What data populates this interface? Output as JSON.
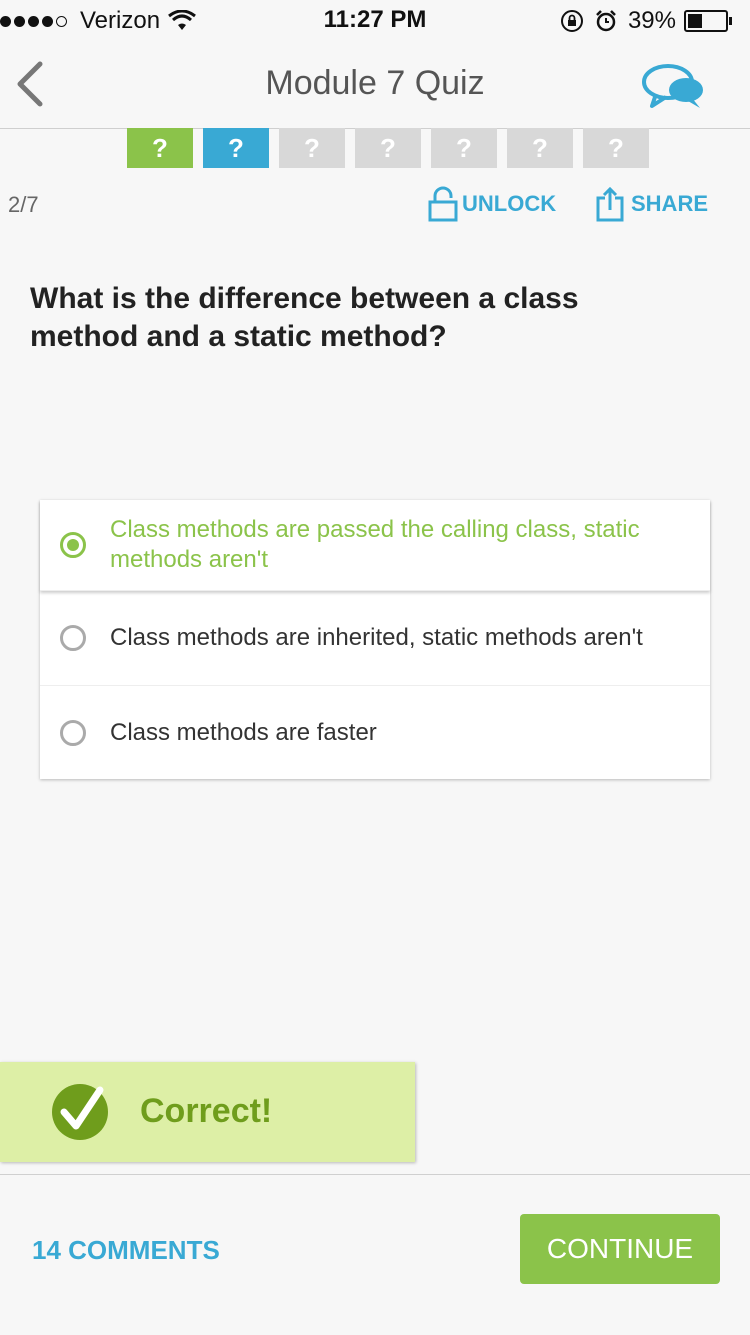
{
  "status_bar": {
    "carrier": "Verizon",
    "time": "11:27 PM",
    "battery": "39%",
    "battery_level": 0.39
  },
  "nav": {
    "title": "Module 7 Quiz",
    "back_icon": "chevron-left-icon",
    "chat_icon": "chat-bubbles-icon"
  },
  "progress": {
    "items": [
      "?",
      "?",
      "?",
      "?",
      "?",
      "?",
      "?"
    ],
    "states": [
      "correct",
      "current",
      "pending",
      "pending",
      "pending",
      "pending",
      "pending"
    ]
  },
  "toolbar": {
    "counter": "2/7",
    "unlock_label": "UNLOCK",
    "share_label": "SHARE"
  },
  "question": {
    "text": "What is the difference between a class method and a static method?"
  },
  "answers": [
    {
      "text": "Class methods are passed the calling class, static methods aren't",
      "selected": true
    },
    {
      "text": "Class methods are inherited, static methods aren't",
      "selected": false
    },
    {
      "text": "Class methods are faster",
      "selected": false
    }
  ],
  "feedback": {
    "text": "Correct!"
  },
  "footer": {
    "comments_label": "14 COMMENTS",
    "continue_label": "CONTINUE"
  },
  "colors": {
    "accent_green": "#8bc34a",
    "accent_blue": "#39a9d4",
    "toast_bg": "#ddefa6"
  }
}
